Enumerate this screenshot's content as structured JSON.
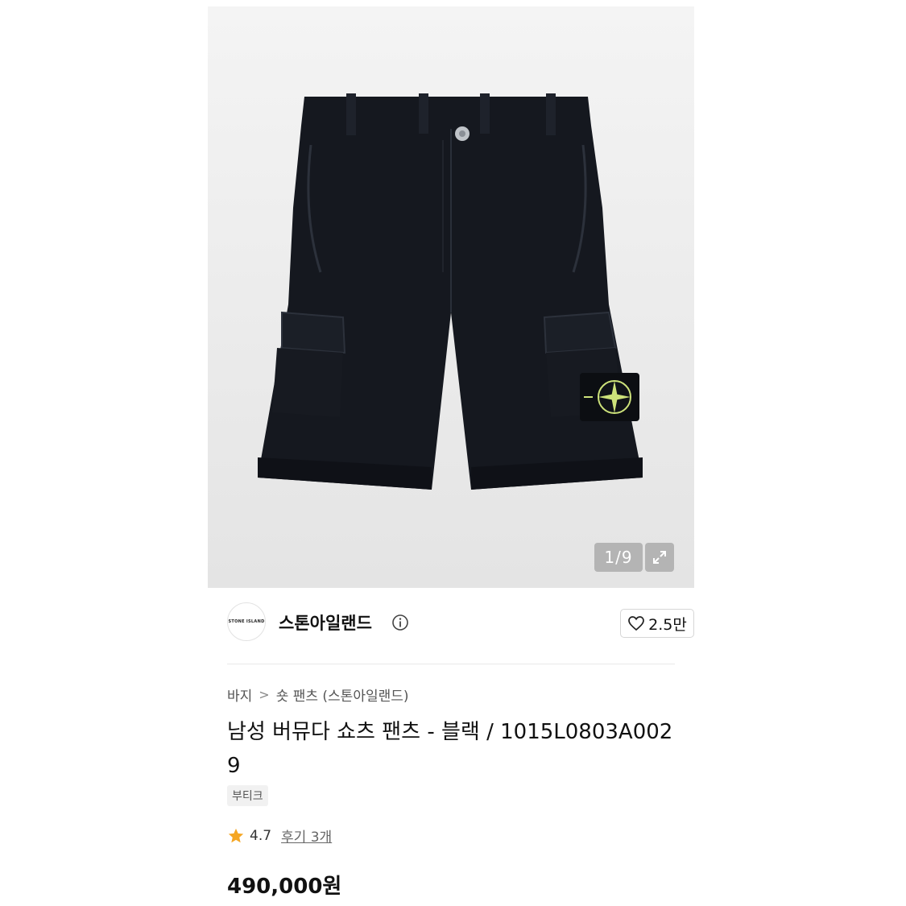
{
  "gallery": {
    "counter": "1/9",
    "current_image": 1,
    "total_images": 9,
    "product_image": "black-bermuda-cargo-shorts-with-compass-badge",
    "expand_icon": "expand-icon"
  },
  "brand": {
    "logo_text": "STONE ISLAND",
    "name": "스톤아일랜드",
    "info_icon": "info-icon"
  },
  "like": {
    "icon": "heart-icon",
    "count": "2.5만"
  },
  "breadcrumb": {
    "items": [
      "바지",
      "숏 팬츠 (스톤아일랜드)"
    ],
    "separator": ">"
  },
  "product": {
    "title": "남성 버뮤다 쇼츠 팬츠 - 블랙 / 1015L0803A0029",
    "tag": "부티크",
    "rating": "4.7",
    "review_link": "후기 3개",
    "price": "490,000원"
  },
  "colors": {
    "star": "#f5a623",
    "shorts": "#15181f",
    "badge": "#cde27a"
  }
}
